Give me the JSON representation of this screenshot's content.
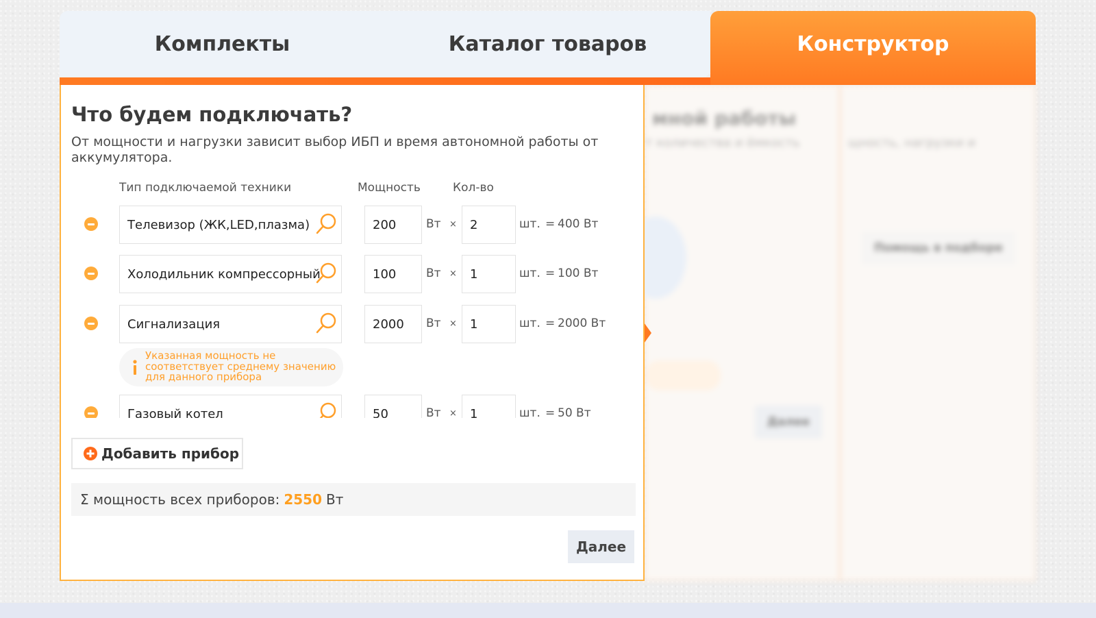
{
  "tabs": [
    {
      "label": "Комплекты"
    },
    {
      "label": "Каталог товаров"
    },
    {
      "label": "Конструктор"
    }
  ],
  "ghost": {
    "title": "мной работы",
    "text1": "т количества и ёмкость",
    "text2": "щность, нагрузки и",
    "help_button": "Помощь в подборе",
    "next_button": "Далее"
  },
  "panel": {
    "title": "Что будем подключать?",
    "subtitle": "От мощности и нагрузки зависит выбор ИБП и время автономной работы от аккумулятора.",
    "col_type": "Тип подключаемой техники",
    "col_power": "Мощность",
    "col_qty": "Кол-во",
    "rows": [
      {
        "name": "Телевизор (ЖК,LED,плазма)",
        "power": "200",
        "unit": "Вт",
        "times": "×",
        "qty": "2",
        "pcs": "шт.",
        "eq": "=",
        "result": "400 Вт"
      },
      {
        "name": "Холодильник компрессорный",
        "power": "100",
        "unit": "Вт",
        "times": "×",
        "qty": "1",
        "pcs": "шт.",
        "eq": "=",
        "result": "100 Вт"
      },
      {
        "name": "Сигнализация",
        "power": "2000",
        "unit": "Вт",
        "times": "×",
        "qty": "1",
        "pcs": "шт.",
        "eq": "=",
        "result": "2000 Вт"
      },
      {
        "name": "Газовый котел",
        "power": "50",
        "unit": "Вт",
        "times": "×",
        "qty": "1",
        "pcs": "шт.",
        "eq": "=",
        "result": "50 Вт"
      }
    ],
    "warning": "Указанная мощность не соответствует среднему значению для данного прибора",
    "add_button": "Добавить прибор",
    "total_label": "Σ мощность всех приборов:",
    "total_value": "2550",
    "total_unit": "Вт",
    "next_button": "Далее"
  },
  "colors": {
    "accent_orange": "#ff7a22",
    "warning_orange": "#ff9f2a",
    "tab_bg": "#eef3f9"
  }
}
